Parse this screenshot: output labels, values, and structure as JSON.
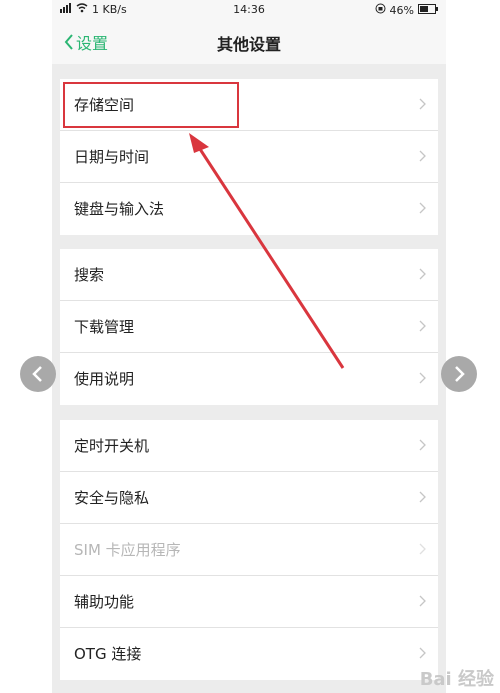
{
  "status_bar": {
    "network": "1 KB/s",
    "time": "14:36",
    "battery": "46%"
  },
  "header": {
    "back_label": "设置",
    "title": "其他设置"
  },
  "groups": [
    {
      "items": [
        {
          "label": "存储空间"
        },
        {
          "label": "日期与时间"
        },
        {
          "label": "键盘与输入法"
        }
      ]
    },
    {
      "items": [
        {
          "label": "搜索"
        },
        {
          "label": "下载管理"
        },
        {
          "label": "使用说明"
        }
      ]
    },
    {
      "items": [
        {
          "label": "定时开关机"
        },
        {
          "label": "安全与隐私"
        },
        {
          "label": "SIM 卡应用程序",
          "disabled": true
        },
        {
          "label": "辅助功能"
        },
        {
          "label": "OTG 连接"
        }
      ]
    }
  ],
  "watermark": "Bai 经验",
  "colors": {
    "accent": "#2bb673",
    "annotation": "#d9363e"
  }
}
